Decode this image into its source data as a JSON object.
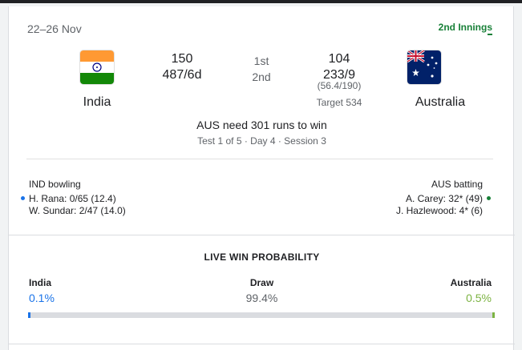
{
  "match": {
    "date": "22–26 Nov",
    "innings_link": "2nd Innings",
    "teams": {
      "home": {
        "name": "India",
        "score_1st": "150",
        "score_2nd": "487/6d"
      },
      "away": {
        "name": "Australia",
        "score_1st": "104",
        "score_2nd": "233/9",
        "overs": "(56.4/190)",
        "target": "Target 534"
      }
    },
    "innings_labels": [
      "1st",
      "2nd"
    ],
    "status": "AUS need 301 runs to win",
    "session": "Test 1 of 5 · Day 4 · Session 3"
  },
  "bowling": {
    "header": "IND bowling",
    "lines": [
      "H. Rana: 0/65 (12.4)",
      "W. Sundar: 2/47 (14.0)"
    ]
  },
  "batting": {
    "header": "AUS batting",
    "lines": [
      "A. Carey: 32* (49)",
      "J. Hazlewood: 4* (6)"
    ]
  },
  "win_probability": {
    "title": "LIVE WIN PROBABILITY",
    "labels": {
      "home": "India",
      "draw": "Draw",
      "away": "Australia"
    },
    "values": {
      "home": "0.1%",
      "draw": "99.4%",
      "away": "0.5%"
    },
    "fractions": {
      "home": 0.001,
      "draw": 0.994,
      "away": 0.005
    }
  },
  "colors": {
    "home": "#1a73e8",
    "draw": "#dadce0",
    "away": "#7cb342",
    "link": "#188038"
  },
  "icons": {
    "home_flag": "india-flag-icon",
    "away_flag": "australia-flag-icon"
  }
}
